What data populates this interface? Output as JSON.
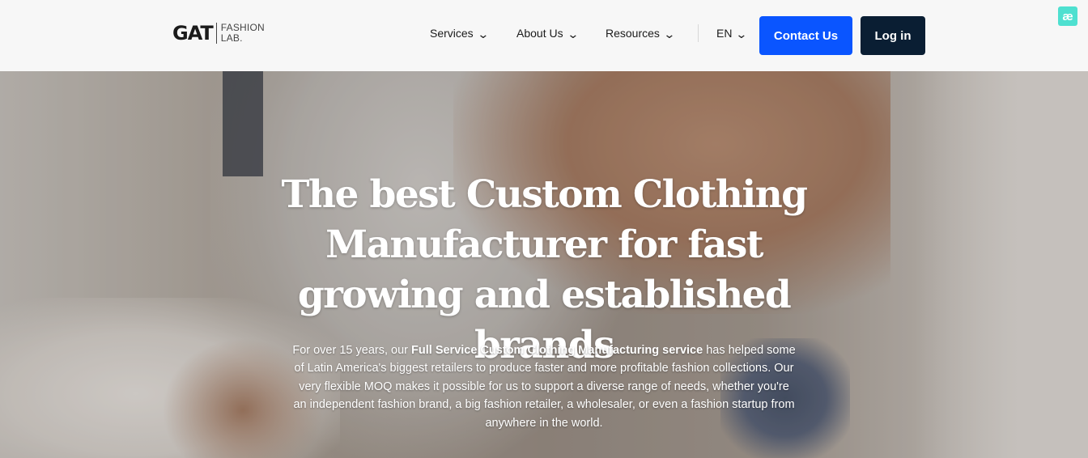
{
  "header": {
    "logo": {
      "main": "GAT",
      "sub_line1": "FASHION",
      "sub_line2": "LAB."
    },
    "nav": {
      "services": "Services",
      "about": "About Us",
      "resources": "Resources",
      "language": "EN"
    },
    "contact_label": "Contact Us",
    "login_label": "Log in",
    "chevron_icon": "chevron-down-icon"
  },
  "extension_badge": {
    "label": "æ",
    "color": "#4ee0d0"
  },
  "hero": {
    "title": "The best Custom Clothing Manufacturer for fast growing and established brands",
    "desc_before": "For over 15 years, our ",
    "desc_bold": "Full Service Custom Clothing Manufacturing service",
    "desc_after": " has helped some of Latin America's biggest retailers to produce faster and more profitable fashion collections. Our very flexible MOQ makes it possible for us to support a diverse range of needs, whether you're an independent fashion brand, a big fashion retailer, a wholesaler, or even a fashion startup from anywhere in the world."
  },
  "colors": {
    "primary_button": "#0a55ff",
    "login_button": "#0a1e33",
    "header_bg": "#f7f7f7"
  }
}
